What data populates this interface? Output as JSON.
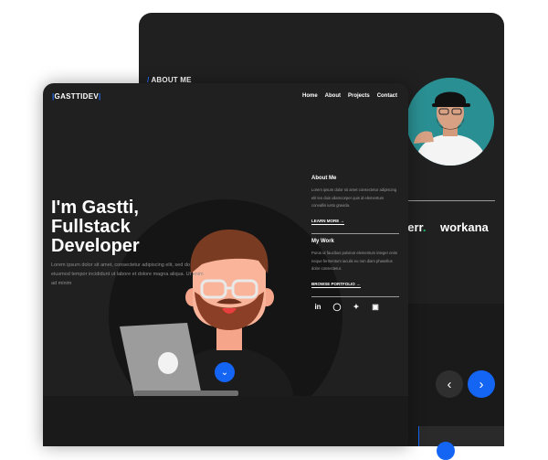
{
  "back_window": {
    "about_label": "ABOUT ME",
    "logos": [
      "verr",
      "workana"
    ],
    "prev_icon": "chevron-left-icon",
    "next_icon": "chevron-right-icon"
  },
  "front_window": {
    "logo": "GASTTIDEV",
    "nav": [
      "Home",
      "About",
      "Projects",
      "Contact"
    ],
    "hero": {
      "line1": "I'm Gastti,",
      "line2": "Fullstack",
      "line3": "Developer",
      "text": "Lorem ipsum dolor sit amet, consectetur adipiscing elit, sed do eiusmod tempor incididunt ut labore et dolore magna aliqua. Ut enim ad minim"
    },
    "about": {
      "title": "About Me",
      "text": "Lorem ipsum dolor sit amet consectetur adipiscing elit leo duis ullamcorper quis id elementum convallis iusto gravida.",
      "link": "LEARN MORE"
    },
    "work": {
      "title": "My Work",
      "text": "Purus ut faucibus pulvinar elementum integer enim neque fermentum iaculis eu non diam phasellus dolor consectetur.",
      "link": "BROWSE PORTFOLIO"
    },
    "socials": [
      "linkedin-icon",
      "github-icon",
      "twitter-icon",
      "instagram-icon"
    ]
  },
  "colors": {
    "accent": "#1565f5",
    "bg": "#202020"
  }
}
